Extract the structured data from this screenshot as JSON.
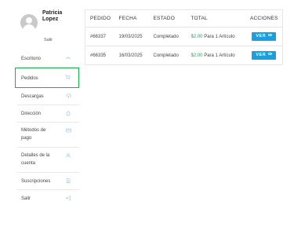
{
  "profile": {
    "name": "Patricia Lopez",
    "logout_label": "Salir"
  },
  "sidebar": {
    "items": [
      {
        "label": "Escritorio",
        "icon": "dashboard-icon"
      },
      {
        "label": "Pedidos",
        "icon": "cart-icon",
        "active": true
      },
      {
        "label": "Descargas",
        "icon": "cloud-download-icon"
      },
      {
        "label": "Dirección",
        "icon": "home-icon"
      },
      {
        "label": "Métodos de pago",
        "icon": "credit-card-icon"
      },
      {
        "label": "Detalles de la cuenta",
        "icon": "user-icon"
      },
      {
        "label": "Suscripciones",
        "icon": "document-icon"
      },
      {
        "label": "Salir",
        "icon": "logout-icon"
      }
    ]
  },
  "orders": {
    "headers": [
      "PEDIDO",
      "FECHA",
      "ESTADO",
      "TOTAL",
      "ACCIONES"
    ],
    "rows": [
      {
        "id": "#66337",
        "date": "19/03/2025",
        "status": "Completado",
        "price": "$2.00",
        "items": "Para 1 Artículo",
        "action": "VER"
      },
      {
        "id": "#66335",
        "date": "16/03/2025",
        "status": "Completado",
        "price": "$2.00",
        "items": "Para 1 Artículo",
        "action": "VER"
      }
    ]
  },
  "colors": {
    "accent_button": "#1aa0e0",
    "active_border": "#1fb04d",
    "price_text": "#27a35a",
    "icon_tint": "#9bc7e8"
  }
}
